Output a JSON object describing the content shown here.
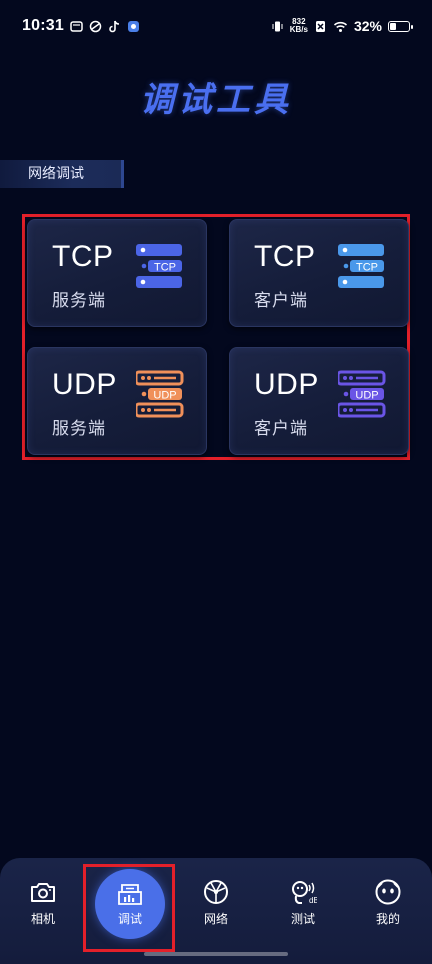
{
  "status_bar": {
    "time": "10:31",
    "net_speed_value": "832",
    "net_speed_unit": "KB/s",
    "battery_percent": "32%",
    "battery_level": 0.32
  },
  "page": {
    "title": "调试工具",
    "section_label": "网络调试",
    "accent_color": "#4a6ff0",
    "highlight_color": "#e3202a"
  },
  "cards": [
    {
      "protocol": "TCP",
      "role": "服务端",
      "icon_label": "TCP",
      "icon_color": "#4b65e6",
      "icon_dot": "#ffffff"
    },
    {
      "protocol": "TCP",
      "role": "客户端",
      "icon_label": "TCP",
      "icon_color": "#4a98ea",
      "icon_dot": "#ffffff"
    },
    {
      "protocol": "UDP",
      "role": "服务端",
      "icon_label": "UDP",
      "icon_color": "#f0905a",
      "icon_dot": "#ffffff"
    },
    {
      "protocol": "UDP",
      "role": "客户端",
      "icon_label": "UDP",
      "icon_color": "#6a55e6",
      "icon_dot": "#ffffff"
    }
  ],
  "nav": {
    "items": [
      {
        "label": "相机",
        "icon": "camera-icon"
      },
      {
        "label": "调试",
        "icon": "debug-icon",
        "active": true
      },
      {
        "label": "网络",
        "icon": "network-globe-icon"
      },
      {
        "label": "测试",
        "icon": "sound-test-icon"
      },
      {
        "label": "我的",
        "icon": "profile-face-icon"
      }
    ]
  }
}
